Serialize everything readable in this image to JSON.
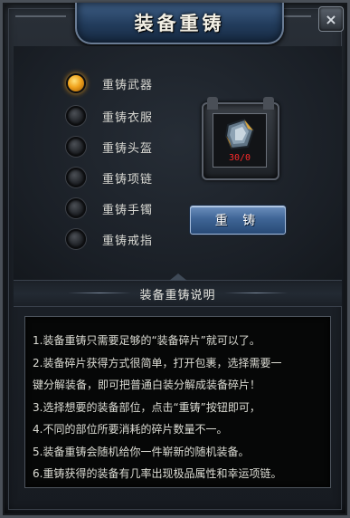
{
  "window": {
    "title": "装备重铸",
    "close_symbol": "×"
  },
  "recast_options": [
    {
      "label": "重铸武器",
      "selected": true
    },
    {
      "label": "重铸衣服",
      "selected": false
    },
    {
      "label": "重铸头盔",
      "selected": false
    },
    {
      "label": "重铸项链",
      "selected": false
    },
    {
      "label": "重铸手镯",
      "selected": false
    },
    {
      "label": "重铸戒指",
      "selected": false
    }
  ],
  "item_slot": {
    "icon": "equipment-fragment-icon",
    "count": "30/0",
    "count_color": "#ff2a2a"
  },
  "recast_button": {
    "label": "重 铸"
  },
  "instructions": {
    "heading": "装备重铸说明",
    "lines": [
      "1.装备重铸只需要足够的“装备碎片”就可以了。",
      "2.装备碎片获得方式很简单，打开包裹，选择需要一",
      "键分解装备，即可把普通白装分解成装备碎片！",
      "3.选择想要的装备部位，点击“重铸”按钮即可，",
      "4.不同的部位所要消耗的碎片数量不一。",
      "5.装备重铸会随机给你一件崭新的随机装备。",
      "6.重铸获得的装备有几率出现极品属性和幸运项链。"
    ]
  },
  "colors": {
    "selected_radio": "#f0a21c",
    "button_blue": "#3f6596",
    "panel_bg": "#1c2128"
  }
}
